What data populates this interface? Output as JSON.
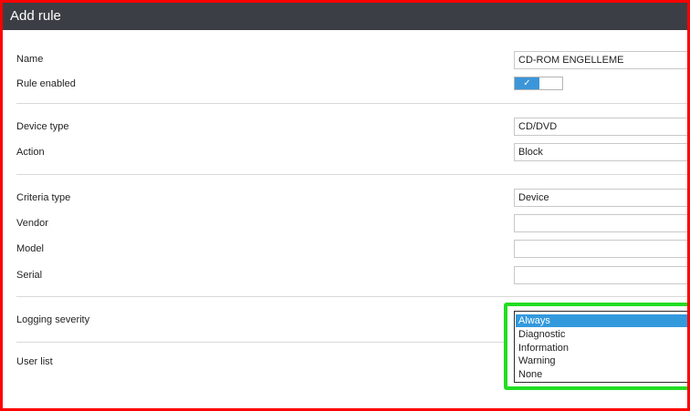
{
  "dialog": {
    "title": "Add rule"
  },
  "fields": {
    "name_label": "Name",
    "name_value": "CD-ROM ENGELLEME",
    "rule_enabled_label": "Rule enabled",
    "rule_enabled_checkmark": "✓",
    "device_type_label": "Device type",
    "device_type_value": "CD/DVD",
    "action_label": "Action",
    "action_value": "Block",
    "criteria_type_label": "Criteria type",
    "criteria_type_value": "Device",
    "vendor_label": "Vendor",
    "vendor_value": "",
    "model_label": "Model",
    "model_value": "",
    "serial_label": "Serial",
    "serial_value": "",
    "logging_severity_label": "Logging severity",
    "user_list_label": "User list"
  },
  "logging_options": [
    "Always",
    "Diagnostic",
    "Information",
    "Warning",
    "None"
  ],
  "logging_selected": "Always",
  "colors": {
    "titlebar": "#3b3f45",
    "toggle_on": "#3b96d9",
    "selected_option": "#3399dd",
    "highlight_border": "#22dd22",
    "frame_border": "#ff0000"
  }
}
